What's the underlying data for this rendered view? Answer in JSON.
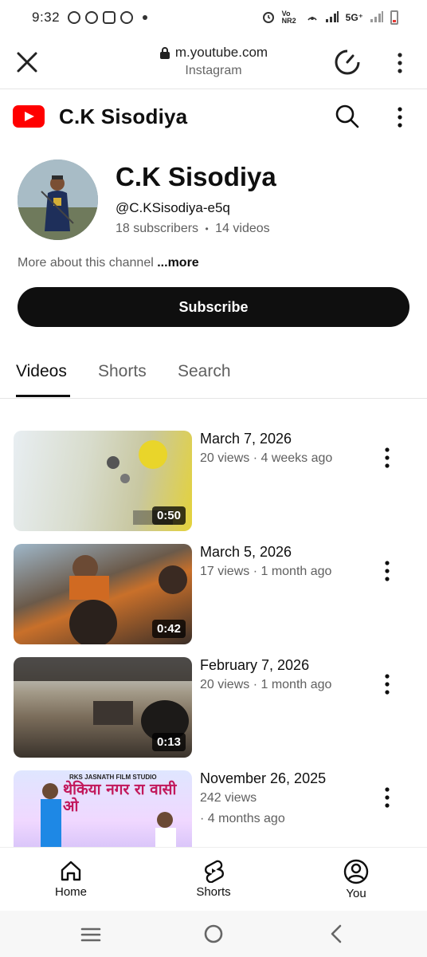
{
  "status_bar": {
    "time": "9:32",
    "network": "5G⁺",
    "volte": "Vo NR2"
  },
  "browser": {
    "url": "m.youtube.com",
    "source": "Instagram"
  },
  "header": {
    "title": "C.K Sisodiya"
  },
  "channel": {
    "name": "C.K Sisodiya",
    "handle": "@C.KSisodiya-e5q",
    "subscribers": "18 subscribers",
    "separator": "•",
    "videos_count": "14 videos",
    "about_text": "More about this channel",
    "about_more": "...more",
    "subscribe_label": "Subscribe"
  },
  "tabs": [
    {
      "label": "Videos",
      "active": true
    },
    {
      "label": "Shorts",
      "active": false
    },
    {
      "label": "Search",
      "active": false
    }
  ],
  "videos": [
    {
      "title": "March 7, 2026",
      "meta": "20 views · 4 weeks ago",
      "meta2": "",
      "duration": "0:50"
    },
    {
      "title": "March 5, 2026",
      "meta": "17 views · 1 month ago",
      "meta2": "",
      "duration": "0:42"
    },
    {
      "title": "February 7, 2026",
      "meta": "20 views · 1 month ago",
      "meta2": "",
      "duration": "0:13"
    },
    {
      "title": "November 26, 2025",
      "meta": "242 views",
      "meta2": "· 4 months ago",
      "duration": "",
      "thumb_text_top": "RKS JASNATH FILM STUDIO",
      "thumb_text_main": "थेकिया नगर रा वासी ओ"
    }
  ],
  "bottom_nav": [
    {
      "label": "Home",
      "icon": "home-icon"
    },
    {
      "label": "Shorts",
      "icon": "shorts-icon"
    },
    {
      "label": "You",
      "icon": "you-icon"
    }
  ],
  "colors": {
    "youtube_red": "#ff0000",
    "text_primary": "#0f0f0f",
    "text_secondary": "#606060",
    "subscribe_bg": "#0f0f0f"
  }
}
